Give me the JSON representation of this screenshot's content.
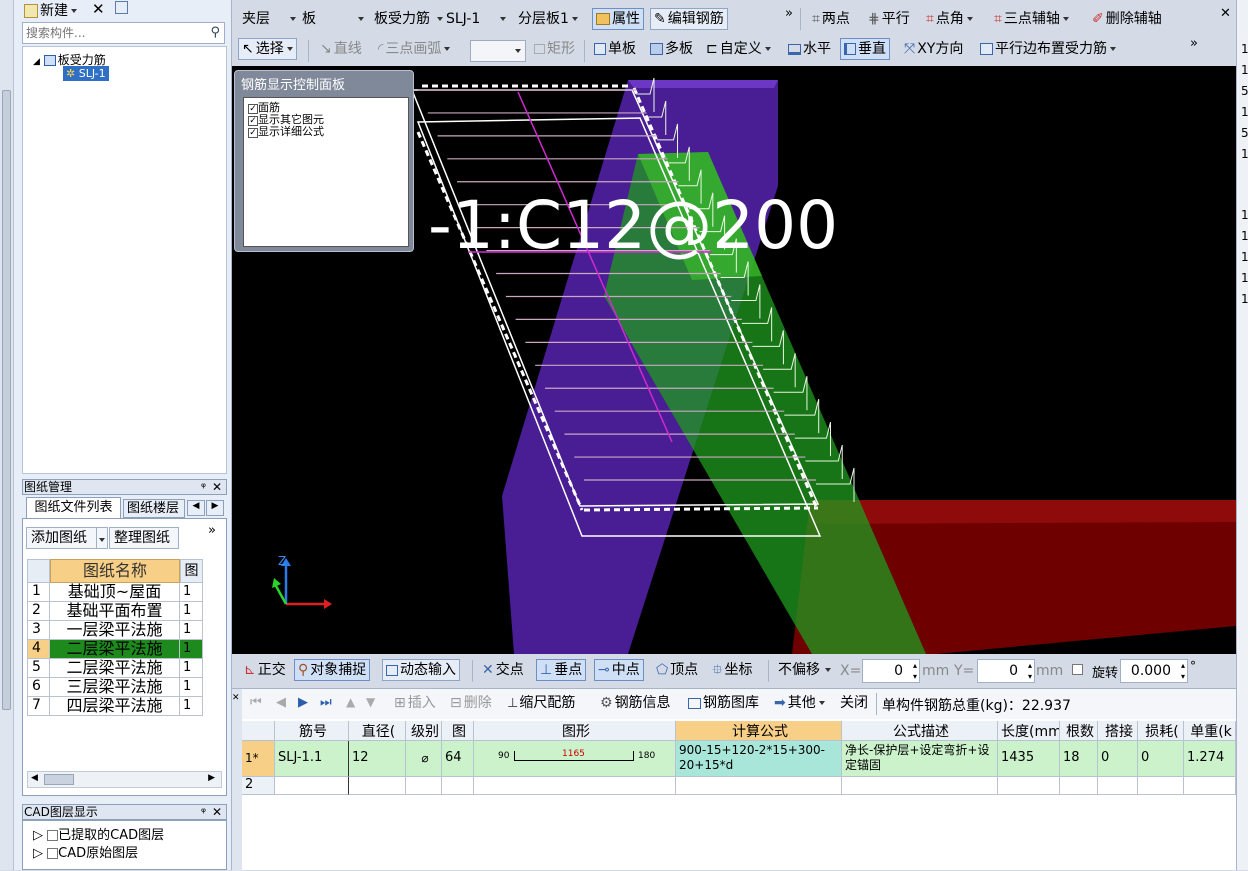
{
  "left": {
    "new_label": "新建",
    "search_placeholder": "搜索构件...",
    "tree_root": "板受力筋",
    "tree_child": "SLJ-1",
    "drawing_mgmt_title": "图纸管理",
    "tab_file_list": "图纸文件列表",
    "tab_floor": "图纸楼层",
    "add_drawing": "添加图纸",
    "organize_drawing": "整理图纸",
    "col_name": "图纸名称",
    "col_fig": "图",
    "drawings": [
      {
        "no": "1",
        "name": "基础顶~屋面",
        "fig": "1"
      },
      {
        "no": "2",
        "name": "基础平面布置",
        "fig": "1"
      },
      {
        "no": "3",
        "name": "一层梁平法施",
        "fig": "1"
      },
      {
        "no": "4",
        "name": "二层梁平法施",
        "fig": "1"
      },
      {
        "no": "5",
        "name": "二层梁平法施",
        "fig": "1"
      },
      {
        "no": "6",
        "name": "三层梁平法施",
        "fig": "1"
      },
      {
        "no": "7",
        "name": "四层梁平法施",
        "fig": "1"
      }
    ],
    "cad_title": "CAD图层显示",
    "cad_layers": [
      "已提取的CAD图层",
      "CAD原始图层"
    ]
  },
  "toolbar1": {
    "floor": "夹层",
    "type": "板",
    "subtype": "板受力筋",
    "component": "SLJ-1",
    "layer": "分层板1",
    "attr": "属性",
    "edit_rebar": "编辑钢筋",
    "two_point": "两点",
    "parallel": "平行",
    "point_angle": "点角",
    "three_point_axis": "三点辅轴",
    "delete_axis": "删除辅轴"
  },
  "toolbar2": {
    "select": "选择",
    "line": "直线",
    "arc": "三点画弧",
    "rect": "矩形",
    "single": "单板",
    "multi": "多板",
    "custom": "自定义",
    "horizontal": "水平",
    "vertical": "垂直",
    "xy": "XY方向",
    "parallel_edge": "平行边布置受力筋"
  },
  "control_panel": {
    "title": "钢筋显示控制面板",
    "items": [
      "面筋",
      "显示其它图元",
      "显示详细公式"
    ]
  },
  "viewport": {
    "label": "-1:C12@200",
    "axis_z": "Z"
  },
  "statusbar": {
    "ortho": "正交",
    "snap": "对象捕捉",
    "dynamic": "动态输入",
    "intersect": "交点",
    "perp": "垂点",
    "mid": "中点",
    "vertex": "顶点",
    "coord": "坐标",
    "offset": "不偏移",
    "x_label": "X=",
    "x_val": "0",
    "mm1": "mm",
    "y_label": "Y=",
    "y_val": "0",
    "mm2": "mm",
    "rotate": "旋转",
    "rotate_val": "0.000",
    "deg": "°"
  },
  "bottom_toolbar": {
    "insert": "插入",
    "delete": "删除",
    "scale": "缩尺配筋",
    "info": "钢筋信息",
    "lib": "钢筋图库",
    "other": "其他",
    "close": "关闭",
    "total": "单构件钢筋总重(kg)：22.937"
  },
  "grid": {
    "headers": [
      "筋号",
      "直径(",
      "级别",
      "图",
      "图形",
      "计算公式",
      "公式描述",
      "长度(mm",
      "根数",
      "搭接",
      "损耗(",
      "单重(k"
    ],
    "row1": {
      "idx": "1*",
      "name": "SLJ-1.1",
      "dia": "12",
      "grade": "⌀",
      "fig": "64",
      "shape_left": "90",
      "shape_mid": "1165",
      "shape_right": "180",
      "formula": "900-15+120-2*15+300-20+15*d",
      "desc": "净长-保护层+设定弯折+设定锚固",
      "length": "1435",
      "count": "18",
      "lap": "0",
      "loss": "0",
      "weight": "1.274"
    },
    "row2_idx": "2"
  },
  "right_edge": [
    "1",
    "1",
    "5",
    "1",
    "5",
    "1",
    "1",
    "1",
    "1",
    "1",
    "1"
  ]
}
